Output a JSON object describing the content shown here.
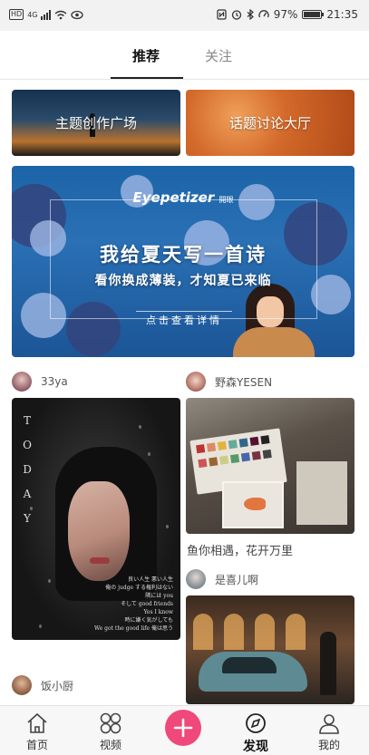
{
  "status_bar": {
    "network_badge": "HD",
    "network_type": "4G",
    "battery_percent": "97%",
    "battery_level": 0.97,
    "time": "21:35"
  },
  "tabs": [
    {
      "label": "推荐",
      "active": true
    },
    {
      "label": "关注",
      "active": false
    }
  ],
  "categories": [
    {
      "label": "主题创作广场"
    },
    {
      "label": "话题讨论大厅"
    }
  ],
  "banner": {
    "logo": "Eyepetizer",
    "logo_sub": "開眼",
    "title": "我给夏天写一首诗",
    "subtitle": "看你换成薄装，才知夏已来临",
    "cta": "点击查看详情"
  },
  "feed": {
    "left": [
      {
        "author": "33ya",
        "image_text": "TODAY",
        "poem": [
          "良い人生 悪い人生",
          "俺の judge する権利はない",
          "隣には you",
          "そして good friends",
          "Yes I know",
          "時に嫌く気がしても",
          "We got the good life 俺は思う"
        ]
      },
      {
        "author": "饭小厨"
      }
    ],
    "right": [
      {
        "author": "野森YESEN",
        "caption": "鱼你相遇，花开万里"
      },
      {
        "author": "是喜儿啊"
      }
    ]
  },
  "bottom_nav": [
    {
      "label": "首页",
      "icon": "home-icon",
      "active": false
    },
    {
      "label": "视频",
      "icon": "video-grid-icon",
      "active": false
    },
    {
      "label": "",
      "icon": "plus-icon",
      "active": false
    },
    {
      "label": "发现",
      "icon": "compass-icon",
      "active": true
    },
    {
      "label": "我的",
      "icon": "profile-icon",
      "active": false
    }
  ],
  "colors": {
    "publish_button": "#f0487a",
    "category_right": "#d3692a",
    "banner": "#1c64a8"
  }
}
